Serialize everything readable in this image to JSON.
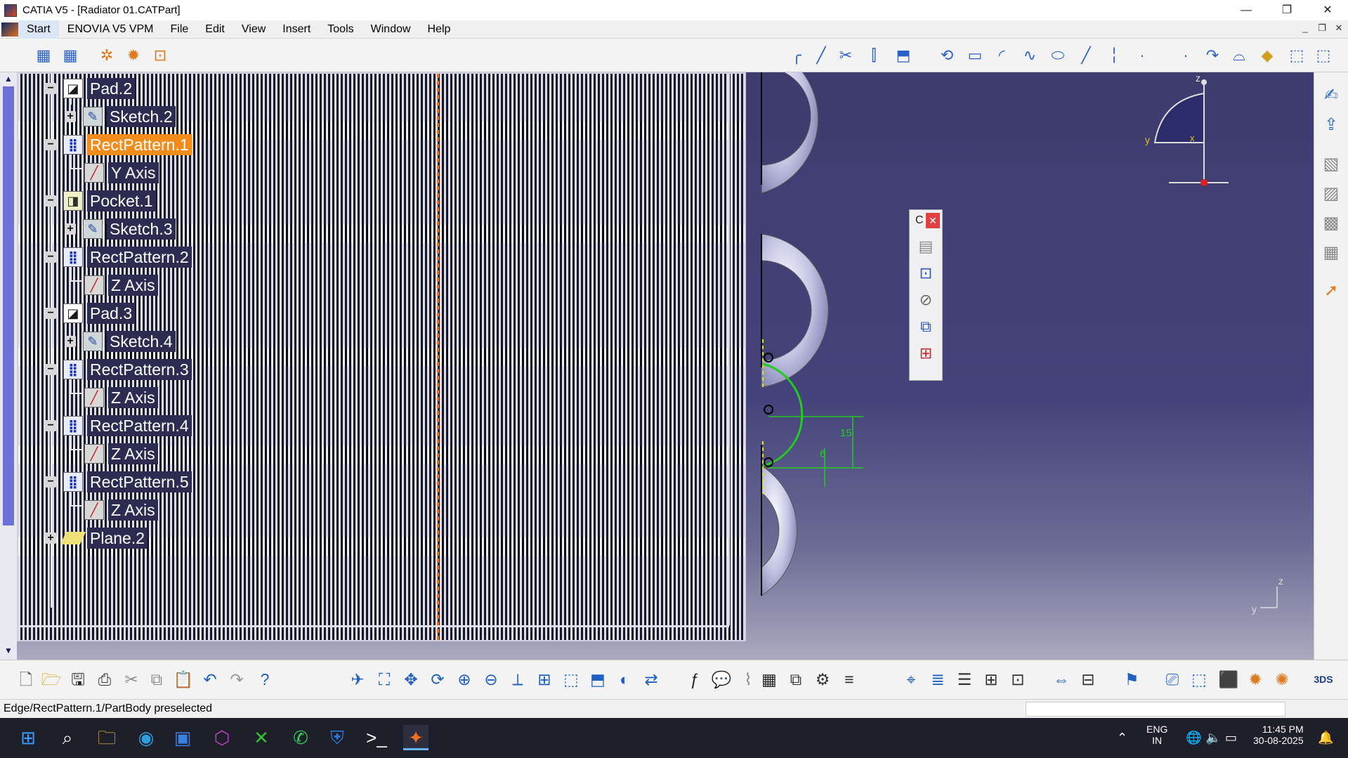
{
  "window": {
    "title": "CATIA V5 - [Radiator 01.CATPart]",
    "minimize": "—",
    "restore": "❐",
    "close": "✕"
  },
  "menu": {
    "items": [
      "Start",
      "ENOVIA V5 VPM",
      "File",
      "Edit",
      "View",
      "Insert",
      "Tools",
      "Window",
      "Help"
    ],
    "mdi_min": "_",
    "mdi_restore": "❐",
    "mdi_close": "✕"
  },
  "tree": {
    "nodes": [
      {
        "label": "Pad.2",
        "icon": "pad-icon",
        "toggle": "−"
      },
      {
        "label": "Sketch.2",
        "icon": "sketch-icon",
        "toggle": "+"
      },
      {
        "label": "RectPattern.1",
        "icon": "rect-pattern-icon",
        "toggle": "−",
        "selected": true
      },
      {
        "label": "Y Axis",
        "icon": "axis-icon"
      },
      {
        "label": "Pocket.1",
        "icon": "pocket-icon",
        "toggle": "−"
      },
      {
        "label": "Sketch.3",
        "icon": "sketch-icon",
        "toggle": "+"
      },
      {
        "label": "RectPattern.2",
        "icon": "rect-pattern-icon",
        "toggle": "−"
      },
      {
        "label": "Z Axis",
        "icon": "axis-icon"
      },
      {
        "label": "Pad.3",
        "icon": "pad-icon",
        "toggle": "−"
      },
      {
        "label": "Sketch.4",
        "icon": "sketch-icon",
        "toggle": "+"
      },
      {
        "label": "RectPattern.3",
        "icon": "rect-pattern-icon",
        "toggle": "−"
      },
      {
        "label": "Z Axis",
        "icon": "axis-icon"
      },
      {
        "label": "RectPattern.4",
        "icon": "rect-pattern-icon",
        "toggle": "−"
      },
      {
        "label": "Z Axis",
        "icon": "axis-icon"
      },
      {
        "label": "RectPattern.5",
        "icon": "rect-pattern-icon",
        "toggle": "−"
      },
      {
        "label": "Z Axis",
        "icon": "axis-icon"
      },
      {
        "label": "Plane.2",
        "icon": "plane-icon",
        "toggle": "+"
      }
    ]
  },
  "floating_toolbar": {
    "title": "C",
    "close": "✕"
  },
  "viewport": {
    "dimension_15": "15",
    "dimension_6": "6",
    "compass_z": "z",
    "compass_y": "y",
    "compass_x": "x",
    "axis_z": "z",
    "axis_y": "y"
  },
  "status": {
    "text": "Edge/RectPattern.1/PartBody preselected"
  },
  "taskbar": {
    "lang_top": "ENG",
    "lang_bottom": "IN",
    "time": "11:45 PM",
    "date": "30-08-2025"
  },
  "colors": {
    "selected_node": "#f28c1a",
    "viewport_bg": "#3e3c6e",
    "sketch_green": "#22cc22"
  }
}
